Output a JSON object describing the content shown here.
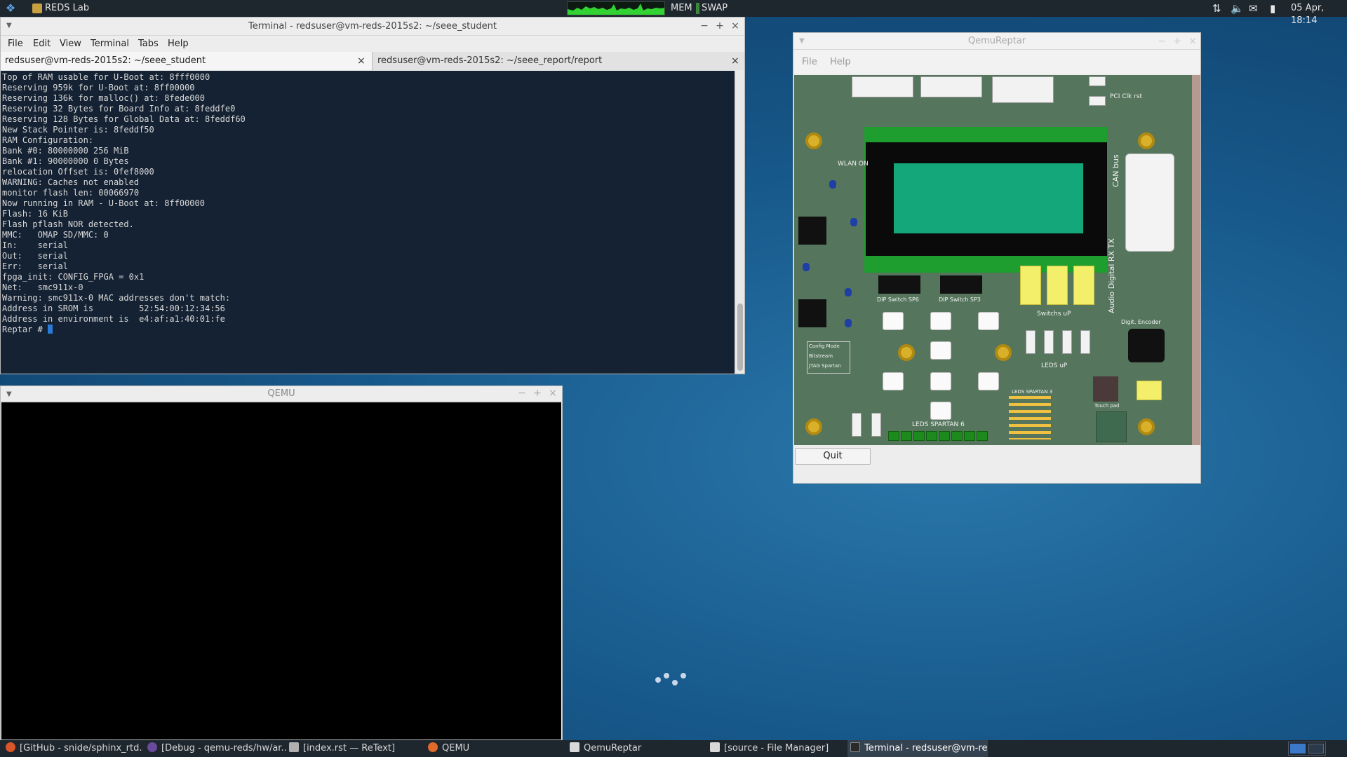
{
  "top_panel": {
    "app_label": "REDS Lab",
    "mem_label": "MEM",
    "swap_label": "SWAP",
    "clock": "05 Apr, 18:14",
    "tray_icons": [
      "network-icon",
      "volume-icon",
      "mail-icon",
      "battery-icon"
    ]
  },
  "terminal": {
    "title": "Terminal - redsuser@vm-reds-2015s2: ~/seee_student",
    "menu": [
      "File",
      "Edit",
      "View",
      "Terminal",
      "Tabs",
      "Help"
    ],
    "tabs": [
      {
        "label": "redsuser@vm-reds-2015s2: ~/seee_student",
        "active": true
      },
      {
        "label": "redsuser@vm-reds-2015s2: ~/seee_report/report",
        "active": false
      }
    ],
    "lines": [
      "Top of RAM usable for U-Boot at: 8fff0000",
      "Reserving 959k for U-Boot at: 8ff00000",
      "Reserving 136k for malloc() at: 8fede000",
      "Reserving 32 Bytes for Board Info at: 8feddfe0",
      "Reserving 128 Bytes for Global Data at: 8feddf60",
      "New Stack Pointer is: 8feddf50",
      "RAM Configuration:",
      "Bank #0: 80000000 256 MiB",
      "Bank #1: 90000000 0 Bytes",
      "relocation Offset is: 0fef8000",
      "WARNING: Caches not enabled",
      "monitor flash len: 00066970",
      "Now running in RAM - U-Boot at: 8ff00000",
      "Flash: 16 KiB",
      "Flash pflash NOR detected.",
      "MMC:   OMAP SD/MMC: 0",
      "In:    serial",
      "Out:   serial",
      "Err:   serial",
      "fpga_init: CONFIG_FPGA = 0x1",
      "Net:   smc911x-0",
      "Warning: smc911x-0 MAC addresses don't match:",
      "Address in SROM is         52:54:00:12:34:56",
      "Address in environment is  e4:af:a1:40:01:fe",
      "",
      "Reptar # "
    ]
  },
  "qemu": {
    "title": "QEMU"
  },
  "reptar": {
    "title": "QemuReptar",
    "menu": [
      "File",
      "Help"
    ],
    "quit_label": "Quit",
    "silk": {
      "dip_sp6": "DIP Switch SP6",
      "dip_sp3": "DIP Switch SP3",
      "switchs_up": "Switchs uP",
      "leds_up": "LEDS uP",
      "leds_spartan3": "LEDS SPARTAN 3",
      "leds_spartan6": "LEDS SPARTAN 6",
      "can_bus": "CAN bus",
      "audio_digital": "Audio Digital RX TX",
      "digit_encoder": "Digit. Encoder",
      "wlan_on": "WLAN ON",
      "touch_pad": "Touch pad",
      "pci_clk": "PCI Clk rst",
      "config_mode": "Config Mode",
      "bitstream": "Bitstream",
      "jtag": "JTAG Spartan"
    }
  },
  "taskbar": {
    "items": [
      {
        "label": "[GitHub - snide/sphinx_rtd...",
        "icon_color": "#d9552a",
        "active": false
      },
      {
        "label": "[Debug - qemu-reds/hw/ar...",
        "icon_color": "#6a4a9a",
        "active": false
      },
      {
        "label": "[index.rst — ReText]",
        "icon_color": "#b0b0b0",
        "active": false
      },
      {
        "label": "QEMU",
        "icon_color": "#e06a2a",
        "active": false
      },
      {
        "label": "QemuReptar",
        "icon_color": "#d8d8d8",
        "active": false
      },
      {
        "label": "[source - File Manager]",
        "icon_color": "#d8d8d8",
        "active": false
      },
      {
        "label": "Terminal - redsuser@vm-re...",
        "icon_color": "#2a2a2a",
        "active": true
      }
    ]
  },
  "colors": {
    "terminal_bg": "#142233",
    "panel_bg": "#1e262e",
    "lcd_green": "#14a77a",
    "pcb_green": "#55765d"
  }
}
